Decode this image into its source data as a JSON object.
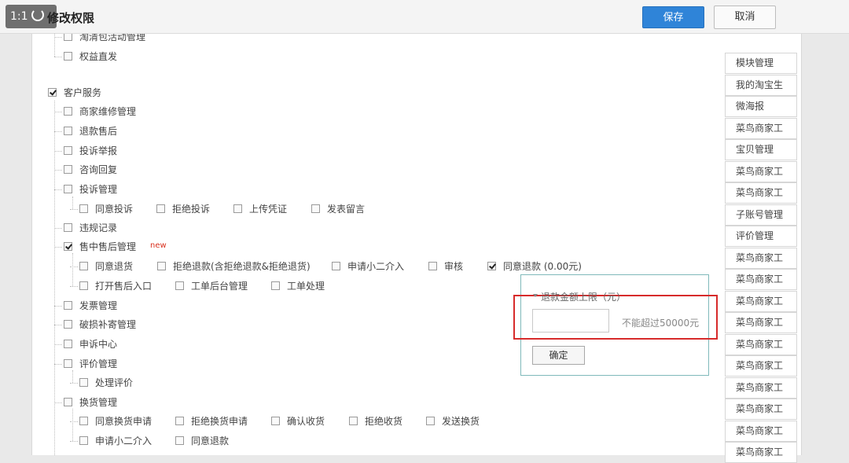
{
  "viewer": {
    "zoom_label": "1:1"
  },
  "dialog": {
    "title": "修改权限",
    "save_label": "保存",
    "cancel_label": "取消"
  },
  "tree": {
    "top": [
      {
        "label": "淘清包活动管理",
        "checked": false
      },
      {
        "label": "权益直发",
        "checked": false
      }
    ],
    "customer_service": {
      "label": "客户服务",
      "checked": true
    },
    "items": [
      {
        "label": "商家维修管理",
        "checked": false
      },
      {
        "label": "退款售后",
        "checked": false
      },
      {
        "label": "投诉举报",
        "checked": false
      },
      {
        "label": "咨询回复",
        "checked": false
      },
      {
        "label": "投诉管理",
        "checked": false
      },
      {
        "label": "违规记录",
        "checked": false
      },
      {
        "label": "售中售后管理",
        "checked": true,
        "badge": "new"
      },
      {
        "label": "发票管理",
        "checked": false
      },
      {
        "label": "破损补寄管理",
        "checked": false
      },
      {
        "label": "申诉中心",
        "checked": false
      },
      {
        "label": "评价管理",
        "checked": false
      },
      {
        "label": "换货管理",
        "checked": false
      }
    ],
    "complaint_sub": [
      {
        "label": "同意投诉",
        "checked": false
      },
      {
        "label": "拒绝投诉",
        "checked": false
      },
      {
        "label": "上传凭证",
        "checked": false
      },
      {
        "label": "发表留言",
        "checked": false
      }
    ],
    "aftersale_sub_row1": [
      {
        "label": "同意退货",
        "checked": false
      },
      {
        "label": "拒绝退款(含拒绝退款&拒绝退货)",
        "checked": false
      },
      {
        "label": "申请小二介入",
        "checked": false
      },
      {
        "label": "审核",
        "checked": false
      },
      {
        "label": "同意退款 (0.00元)",
        "checked": true
      }
    ],
    "aftersale_sub_row2": [
      {
        "label": "打开售后入口",
        "checked": false
      },
      {
        "label": "工单后台管理",
        "checked": false
      },
      {
        "label": "工单处理",
        "checked": false
      }
    ],
    "review_sub": [
      {
        "label": "处理评价",
        "checked": false
      }
    ],
    "exchange_sub_row1": [
      {
        "label": "同意换货申请",
        "checked": false
      },
      {
        "label": "拒绝换货申请",
        "checked": false
      },
      {
        "label": "确认收货",
        "checked": false
      },
      {
        "label": "拒绝收货",
        "checked": false
      },
      {
        "label": "发送换货",
        "checked": false
      }
    ],
    "exchange_sub_row2": [
      {
        "label": "申请小二介入",
        "checked": false
      },
      {
        "label": "同意退款",
        "checked": false
      }
    ]
  },
  "refund_popup": {
    "label": "退款金额上限（元）",
    "input_value": "",
    "hint": "不能超过50000元",
    "confirm_label": "确定"
  },
  "sidebar": [
    "模块管理",
    "我的淘宝生",
    "微海报",
    "菜鸟商家工",
    "宝贝管理",
    "菜鸟商家工",
    "菜鸟商家工",
    "子账号管理",
    "评价管理",
    "菜鸟商家工",
    "菜鸟商家工",
    "菜鸟商家工",
    "菜鸟商家工",
    "菜鸟商家工",
    "菜鸟商家工",
    "菜鸟商家工",
    "菜鸟商家工",
    "菜鸟商家工",
    "菜鸟商家工"
  ]
}
